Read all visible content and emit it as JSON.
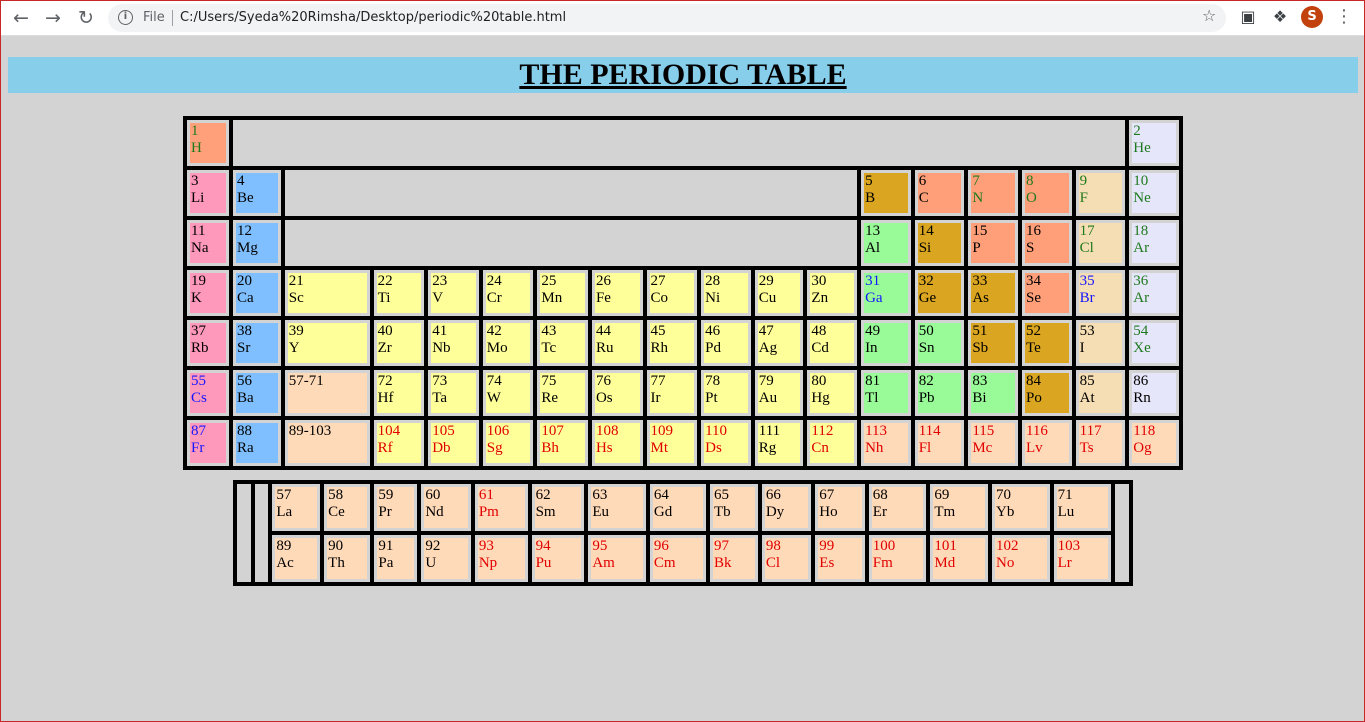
{
  "browser": {
    "file_label": "File",
    "url": "C:/Users/Syeda%20Rimsha/Desktop/periodic%20table.html",
    "profile_initial": "S"
  },
  "page": {
    "title": "THE PERIODIC TABLE"
  },
  "colors": {
    "hydrogen": "#ffa07a",
    "alkali_metal": "#ff99bb",
    "alkaline_earth": "#80bfff",
    "transition_metal": "#ffff99",
    "post_transition": "#98fb98",
    "metalloid": "#daa520",
    "nonmetal": "#ff9f79",
    "halogen": "#f5deb3",
    "noble_gas": "#e6e6fa",
    "f_block": "#ffdab9",
    "gap": "#d3d3d3",
    "text_black": "#000000",
    "text_green": "#1e7a1e",
    "text_blue": "#1515ff",
    "text_red": "#e00000",
    "text_default": "#000000"
  },
  "main_table": {
    "rows": [
      [
        {
          "n": "1",
          "s": "H",
          "t": "green",
          "bg": "hydrogen"
        },
        {
          "gap": true,
          "colspan": 16
        },
        {
          "n": "2",
          "s": "He",
          "t": "green",
          "bg": "noble_gas"
        }
      ],
      [
        {
          "n": "3",
          "s": "Li",
          "t": "black",
          "bg": "alkali_metal"
        },
        {
          "n": "4",
          "s": "Be",
          "t": "black",
          "bg": "alkaline_earth"
        },
        {
          "gap": true,
          "colspan": 10
        },
        {
          "n": "5",
          "s": "B",
          "t": "black",
          "bg": "metalloid"
        },
        {
          "n": "6",
          "s": "C",
          "t": "black",
          "bg": "nonmetal"
        },
        {
          "n": "7",
          "s": "N",
          "t": "green",
          "bg": "nonmetal"
        },
        {
          "n": "8",
          "s": "O",
          "t": "green",
          "bg": "nonmetal"
        },
        {
          "n": "9",
          "s": "F",
          "t": "green",
          "bg": "halogen"
        },
        {
          "n": "10",
          "s": "Ne",
          "t": "green",
          "bg": "noble_gas"
        }
      ],
      [
        {
          "n": "11",
          "s": "Na",
          "t": "black",
          "bg": "alkali_metal"
        },
        {
          "n": "12",
          "s": "Mg",
          "t": "black",
          "bg": "alkaline_earth"
        },
        {
          "gap": true,
          "colspan": 10
        },
        {
          "n": "13",
          "s": "Al",
          "t": "black",
          "bg": "post_transition"
        },
        {
          "n": "14",
          "s": "Si",
          "t": "black",
          "bg": "metalloid"
        },
        {
          "n": "15",
          "s": "P",
          "t": "black",
          "bg": "nonmetal"
        },
        {
          "n": "16",
          "s": "S",
          "t": "black",
          "bg": "nonmetal"
        },
        {
          "n": "17",
          "s": "Cl",
          "t": "green",
          "bg": "halogen"
        },
        {
          "n": "18",
          "s": "Ar",
          "t": "green",
          "bg": "noble_gas"
        }
      ],
      [
        {
          "n": "19",
          "s": "K",
          "t": "black",
          "bg": "alkali_metal"
        },
        {
          "n": "20",
          "s": "Ca",
          "t": "black",
          "bg": "alkaline_earth"
        },
        {
          "n": "21",
          "s": "Sc",
          "t": "black",
          "bg": "transition_metal"
        },
        {
          "n": "22",
          "s": "Ti",
          "t": "black",
          "bg": "transition_metal"
        },
        {
          "n": "23",
          "s": "V",
          "t": "black",
          "bg": "transition_metal"
        },
        {
          "n": "24",
          "s": "Cr",
          "t": "black",
          "bg": "transition_metal"
        },
        {
          "n": "25",
          "s": "Mn",
          "t": "black",
          "bg": "transition_metal"
        },
        {
          "n": "26",
          "s": "Fe",
          "t": "black",
          "bg": "transition_metal"
        },
        {
          "n": "27",
          "s": "Co",
          "t": "black",
          "bg": "transition_metal"
        },
        {
          "n": "28",
          "s": "Ni",
          "t": "black",
          "bg": "transition_metal"
        },
        {
          "n": "29",
          "s": "Cu",
          "t": "black",
          "bg": "transition_metal"
        },
        {
          "n": "30",
          "s": "Zn",
          "t": "black",
          "bg": "transition_metal"
        },
        {
          "n": "31",
          "s": "Ga",
          "t": "blue",
          "bg": "post_transition"
        },
        {
          "n": "32",
          "s": "Ge",
          "t": "black",
          "bg": "metalloid"
        },
        {
          "n": "33",
          "s": "As",
          "t": "black",
          "bg": "metalloid"
        },
        {
          "n": "34",
          "s": "Se",
          "t": "black",
          "bg": "nonmetal"
        },
        {
          "n": "35",
          "s": "Br",
          "t": "blue",
          "bg": "halogen"
        },
        {
          "n": "36",
          "s": "Ar",
          "t": "green",
          "bg": "noble_gas"
        }
      ],
      [
        {
          "n": "37",
          "s": "Rb",
          "t": "black",
          "bg": "alkali_metal"
        },
        {
          "n": "38",
          "s": "Sr",
          "t": "black",
          "bg": "alkaline_earth"
        },
        {
          "n": "39",
          "s": "Y",
          "t": "black",
          "bg": "transition_metal"
        },
        {
          "n": "40",
          "s": "Zr",
          "t": "black",
          "bg": "transition_metal"
        },
        {
          "n": "41",
          "s": "Nb",
          "t": "black",
          "bg": "transition_metal"
        },
        {
          "n": "42",
          "s": "Mo",
          "t": "black",
          "bg": "transition_metal"
        },
        {
          "n": "43",
          "s": "Tc",
          "t": "black",
          "bg": "transition_metal"
        },
        {
          "n": "44",
          "s": "Ru",
          "t": "black",
          "bg": "transition_metal"
        },
        {
          "n": "45",
          "s": "Rh",
          "t": "black",
          "bg": "transition_metal"
        },
        {
          "n": "46",
          "s": "Pd",
          "t": "black",
          "bg": "transition_metal"
        },
        {
          "n": "47",
          "s": "Ag",
          "t": "black",
          "bg": "transition_metal"
        },
        {
          "n": "48",
          "s": "Cd",
          "t": "black",
          "bg": "transition_metal"
        },
        {
          "n": "49",
          "s": "In",
          "t": "black",
          "bg": "post_transition"
        },
        {
          "n": "50",
          "s": "Sn",
          "t": "black",
          "bg": "post_transition"
        },
        {
          "n": "51",
          "s": "Sb",
          "t": "black",
          "bg": "metalloid"
        },
        {
          "n": "52",
          "s": "Te",
          "t": "black",
          "bg": "metalloid"
        },
        {
          "n": "53",
          "s": "I",
          "t": "black",
          "bg": "halogen"
        },
        {
          "n": "54",
          "s": "Xe",
          "t": "green",
          "bg": "noble_gas"
        }
      ],
      [
        {
          "n": "55",
          "s": "Cs",
          "t": "blue",
          "bg": "alkali_metal"
        },
        {
          "n": "56",
          "s": "Ba",
          "t": "black",
          "bg": "alkaline_earth"
        },
        {
          "range": "57-71",
          "bg": "f_block"
        },
        {
          "n": "72",
          "s": "Hf",
          "t": "black",
          "bg": "transition_metal"
        },
        {
          "n": "73",
          "s": "Ta",
          "t": "black",
          "bg": "transition_metal"
        },
        {
          "n": "74",
          "s": "W",
          "t": "black",
          "bg": "transition_metal"
        },
        {
          "n": "75",
          "s": "Re",
          "t": "black",
          "bg": "transition_metal"
        },
        {
          "n": "76",
          "s": "Os",
          "t": "black",
          "bg": "transition_metal"
        },
        {
          "n": "77",
          "s": "Ir",
          "t": "black",
          "bg": "transition_metal"
        },
        {
          "n": "78",
          "s": "Pt",
          "t": "black",
          "bg": "transition_metal"
        },
        {
          "n": "79",
          "s": "Au",
          "t": "black",
          "bg": "transition_metal"
        },
        {
          "n": "80",
          "s": "Hg",
          "t": "black",
          "bg": "transition_metal"
        },
        {
          "n": "81",
          "s": "Tl",
          "t": "black",
          "bg": "post_transition"
        },
        {
          "n": "82",
          "s": "Pb",
          "t": "black",
          "bg": "post_transition"
        },
        {
          "n": "83",
          "s": "Bi",
          "t": "black",
          "bg": "post_transition"
        },
        {
          "n": "84",
          "s": "Po",
          "t": "black",
          "bg": "metalloid"
        },
        {
          "n": "85",
          "s": "At",
          "t": "black",
          "bg": "halogen"
        },
        {
          "n": "86",
          "s": "Rn",
          "t": "black",
          "bg": "noble_gas"
        }
      ],
      [
        {
          "n": "87",
          "s": "Fr",
          "t": "blue",
          "bg": "alkali_metal"
        },
        {
          "n": "88",
          "s": "Ra",
          "t": "black",
          "bg": "alkaline_earth"
        },
        {
          "range": "89-103",
          "bg": "f_block"
        },
        {
          "n": "104",
          "s": "Rf",
          "t": "red",
          "bg": "transition_metal"
        },
        {
          "n": "105",
          "s": "Db",
          "t": "red",
          "bg": "transition_metal"
        },
        {
          "n": "106",
          "s": "Sg",
          "t": "red",
          "bg": "transition_metal"
        },
        {
          "n": "107",
          "s": "Bh",
          "t": "red",
          "bg": "transition_metal"
        },
        {
          "n": "108",
          "s": "Hs",
          "t": "red",
          "bg": "transition_metal"
        },
        {
          "n": "109",
          "s": "Mt",
          "t": "red",
          "bg": "transition_metal"
        },
        {
          "n": "110",
          "s": "Ds",
          "t": "red",
          "bg": "transition_metal"
        },
        {
          "n": "111",
          "s": "Rg",
          "t": "black",
          "bg": "transition_metal"
        },
        {
          "n": "112",
          "s": "Cn",
          "t": "red",
          "bg": "transition_metal"
        },
        {
          "n": "113",
          "s": "Nh",
          "t": "red",
          "bg": "f_block"
        },
        {
          "n": "114",
          "s": "Fl",
          "t": "red",
          "bg": "f_block"
        },
        {
          "n": "115",
          "s": "Mc",
          "t": "red",
          "bg": "f_block"
        },
        {
          "n": "116",
          "s": "Lv",
          "t": "red",
          "bg": "f_block"
        },
        {
          "n": "117",
          "s": "Ts",
          "t": "red",
          "bg": "f_block"
        },
        {
          "n": "118",
          "s": "Og",
          "t": "red",
          "bg": "f_block"
        }
      ]
    ]
  },
  "sub_table": {
    "rows": [
      [
        {
          "gap": true,
          "rowspan": 2
        },
        {
          "gap": true,
          "rowspan": 2
        },
        {
          "n": "57",
          "s": "La",
          "t": "black",
          "bg": "f_block"
        },
        {
          "n": "58",
          "s": "Ce",
          "t": "black",
          "bg": "f_block"
        },
        {
          "n": "59",
          "s": "Pr",
          "t": "black",
          "bg": "f_block"
        },
        {
          "n": "60",
          "s": "Nd",
          "t": "black",
          "bg": "f_block"
        },
        {
          "n": "61",
          "s": "Pm",
          "t": "red",
          "bg": "f_block"
        },
        {
          "n": "62",
          "s": "Sm",
          "t": "black",
          "bg": "f_block"
        },
        {
          "n": "63",
          "s": "Eu",
          "t": "black",
          "bg": "f_block"
        },
        {
          "n": "64",
          "s": "Gd",
          "t": "black",
          "bg": "f_block"
        },
        {
          "n": "65",
          "s": "Tb",
          "t": "black",
          "bg": "f_block"
        },
        {
          "n": "66",
          "s": "Dy",
          "t": "black",
          "bg": "f_block"
        },
        {
          "n": "67",
          "s": "Ho",
          "t": "black",
          "bg": "f_block"
        },
        {
          "n": "68",
          "s": "Er",
          "t": "black",
          "bg": "f_block"
        },
        {
          "n": "69",
          "s": "Tm",
          "t": "black",
          "bg": "f_block"
        },
        {
          "n": "70",
          "s": "Yb",
          "t": "black",
          "bg": "f_block"
        },
        {
          "n": "71",
          "s": "Lu",
          "t": "black",
          "bg": "f_block"
        },
        {
          "gap": true,
          "rowspan": 2
        }
      ],
      [
        {
          "n": "89",
          "s": "Ac",
          "t": "black",
          "bg": "f_block"
        },
        {
          "n": "90",
          "s": "Th",
          "t": "black",
          "bg": "f_block"
        },
        {
          "n": "91",
          "s": "Pa",
          "t": "black",
          "bg": "f_block"
        },
        {
          "n": "92",
          "s": "U",
          "t": "black",
          "bg": "f_block"
        },
        {
          "n": "93",
          "s": "Np",
          "t": "red",
          "bg": "f_block"
        },
        {
          "n": "94",
          "s": "Pu",
          "t": "red",
          "bg": "f_block"
        },
        {
          "n": "95",
          "s": "Am",
          "t": "red",
          "bg": "f_block"
        },
        {
          "n": "96",
          "s": "Cm",
          "t": "red",
          "bg": "f_block"
        },
        {
          "n": "97",
          "s": "Bk",
          "t": "red",
          "bg": "f_block"
        },
        {
          "n": "98",
          "s": "Cl",
          "t": "red",
          "bg": "f_block"
        },
        {
          "n": "99",
          "s": "Es",
          "t": "red",
          "bg": "f_block"
        },
        {
          "n": "100",
          "s": "Fm",
          "t": "red",
          "bg": "f_block"
        },
        {
          "n": "101",
          "s": "Md",
          "t": "red",
          "bg": "f_block"
        },
        {
          "n": "102",
          "s": "No",
          "t": "red",
          "bg": "f_block"
        },
        {
          "n": "103",
          "s": "Lr",
          "t": "red",
          "bg": "f_block"
        }
      ]
    ]
  }
}
